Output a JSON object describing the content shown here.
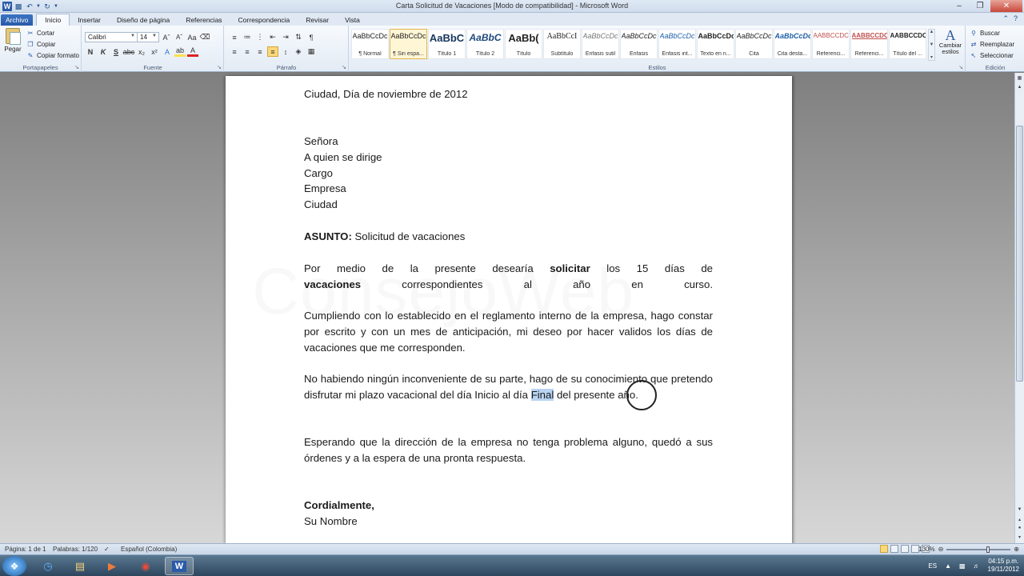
{
  "window": {
    "title": "Carta Solicitud de Vacaciones [Modo de compatibilidad]  -  Microsoft Word"
  },
  "tabs": [
    "Archivo",
    "Inicio",
    "Insertar",
    "Diseño de página",
    "Referencias",
    "Correspondencia",
    "Revisar",
    "Vista"
  ],
  "ribbon": {
    "clipboard": {
      "paste": "Pegar",
      "cut": "Cortar",
      "copy": "Copiar",
      "format_painter": "Copiar formato",
      "label": "Portapapeles"
    },
    "font": {
      "name": "Calibri",
      "size": "14",
      "label": "Fuente"
    },
    "paragraph": {
      "label": "Párrafo"
    },
    "styles": {
      "label": "Estilos",
      "items": [
        {
          "sample": "AaBbCcDc",
          "name": "¶ Normal"
        },
        {
          "sample": "AaBbCcDc",
          "name": "¶ Sin espa..."
        },
        {
          "sample": "AaBbC",
          "name": "Título 1"
        },
        {
          "sample": "AaBbC",
          "name": "Título 2"
        },
        {
          "sample": "AaBb(",
          "name": "Título"
        },
        {
          "sample": "AaBbCcI",
          "name": "Subtítulo"
        },
        {
          "sample": "AaBbCcDc",
          "name": "Énfasis sutil"
        },
        {
          "sample": "AaBbCcDc",
          "name": "Énfasis"
        },
        {
          "sample": "AaBbCcDc",
          "name": "Énfasis int..."
        },
        {
          "sample": "AaBbCcDc",
          "name": "Texto en n..."
        },
        {
          "sample": "AaBbCcDc",
          "name": "Cita"
        },
        {
          "sample": "AaBbCcDc",
          "name": "Cita desta..."
        },
        {
          "sample": "AABBCCDC",
          "name": "Referenci..."
        },
        {
          "sample": "AABBCCDC",
          "name": "Referenci..."
        },
        {
          "sample": "AABBCCDC",
          "name": "Título del ..."
        }
      ],
      "change": "Cambiar estilos"
    },
    "editing": {
      "find": "Buscar",
      "replace": "Reemplazar",
      "select": "Seleccionar",
      "label": "Edición"
    }
  },
  "document": {
    "date_line": "Ciudad, Día de noviembre de 2012",
    "recipient": [
      "Señora",
      "A quien se dirige",
      "Cargo",
      "Empresa",
      "Ciudad"
    ],
    "subject_label": "ASUNTO:",
    "subject_text": " Solicitud de vacaciones",
    "p1_a": "Por medio de la presente desearía ",
    "p1_b": "solicitar",
    "p1_c": " los 15 días de",
    "p1_d": "vacaciones",
    "p1_e": " correspondientes al año en curso.",
    "p2": "Cumpliendo con lo establecido en el reglamento interno de la empresa, hago constar por escrito y con un mes de anticipación, mi deseo por hacer validos los días de vacaciones que me corresponden.",
    "p3_a": "No habiendo ningún inconveniente de su parte, hago de su conocimiento que pretendo disfrutar mi plazo vacacional del día Inicio al día ",
    "p3_sel": "Final",
    "p3_b": " del presente año.",
    "p4": "Esperando que la dirección de la empresa no tenga  problema alguno, quedó a sus órdenes y a la espera de una pronta respuesta.",
    "closing": "Cordialmente,",
    "signature": "Su Nombre",
    "watermark": "ConsejoWeb"
  },
  "status": {
    "page": "Página: 1 de 1",
    "words": "Palabras: 1/120",
    "language": "Español (Colombia)",
    "zoom": "130%"
  },
  "taskbar": {
    "lang": "ES",
    "time": "04:15 p.m.",
    "date": "19/11/2012"
  },
  "colors": {
    "file_tab": "#2a5aa8",
    "selection": "#b9d4f2"
  }
}
